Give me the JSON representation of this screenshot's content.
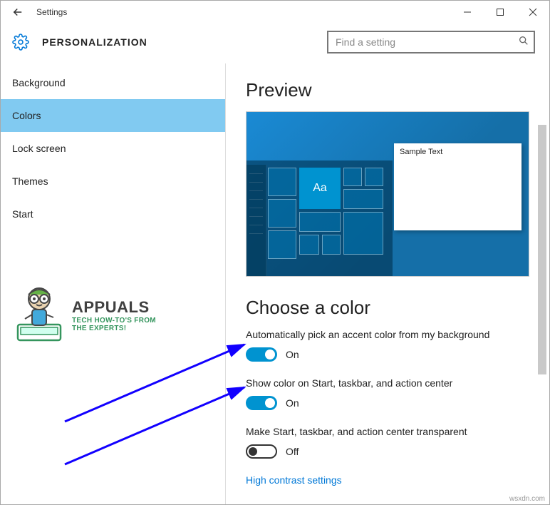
{
  "window": {
    "title": "Settings"
  },
  "header": {
    "page_title": "PERSONALIZATION"
  },
  "search": {
    "placeholder": "Find a setting"
  },
  "sidebar": {
    "items": [
      {
        "label": "Background",
        "active": false
      },
      {
        "label": "Colors",
        "active": true
      },
      {
        "label": "Lock screen",
        "active": false
      },
      {
        "label": "Themes",
        "active": false
      },
      {
        "label": "Start",
        "active": false
      }
    ]
  },
  "preview": {
    "heading": "Preview",
    "sample_window_text": "Sample Text",
    "aa_tile": "Aa"
  },
  "choose_color_heading": "Choose a color",
  "settings": {
    "auto_pick": {
      "label": "Automatically pick an accent color from my background",
      "state": "On",
      "on": true
    },
    "show_color": {
      "label": "Show color on Start, taskbar, and action center",
      "state": "On",
      "on": true
    },
    "transparent": {
      "label": "Make Start, taskbar, and action center transparent",
      "state": "Off",
      "on": false
    }
  },
  "link_high_contrast": "High contrast settings",
  "watermark": {
    "title": "APPUALS",
    "sub1": "TECH HOW-TO'S FROM",
    "sub2": "THE EXPERTS!"
  },
  "source_mark": "wsxdn.com"
}
